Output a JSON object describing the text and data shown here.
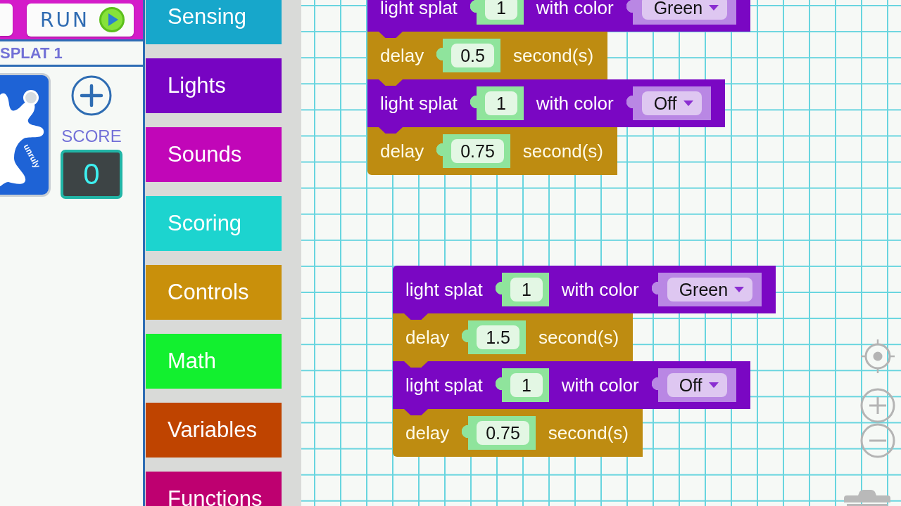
{
  "toolbar": {
    "run_button": {
      "label": "RUN"
    }
  },
  "device": {
    "name": "SPLAT 1",
    "logo_text": "unruly",
    "score_label": "SCORE",
    "score": "0"
  },
  "categories": [
    {
      "label": "Sensing",
      "color": "#17a7cb"
    },
    {
      "label": "Lights",
      "color": "#7704c2"
    },
    {
      "label": "Sounds",
      "color": "#c106b8"
    },
    {
      "label": "Scoring",
      "color": "#1cd4cf"
    },
    {
      "label": "Controls",
      "color": "#c9900b"
    },
    {
      "label": "Math",
      "color": "#12f02f"
    },
    {
      "label": "Variables",
      "color": "#bf4400"
    },
    {
      "label": "Functions",
      "color": "#be0070"
    }
  ],
  "workspace": {
    "stacks": [
      {
        "blocks": [
          {
            "kind": "light",
            "label": "light splat",
            "number": "1",
            "color_label": "with color",
            "color_choice": "Green"
          },
          {
            "kind": "delay",
            "label": "delay",
            "number": "0.5",
            "unit": "second(s)"
          },
          {
            "kind": "light",
            "label": "light splat",
            "number": "1",
            "color_label": "with color",
            "color_choice": "Off"
          },
          {
            "kind": "delay",
            "label": "delay",
            "number": "0.75",
            "unit": "second(s)"
          }
        ]
      },
      {
        "blocks": [
          {
            "kind": "light",
            "label": "light splat",
            "number": "1",
            "color_label": "with color",
            "color_choice": "Green"
          },
          {
            "kind": "delay",
            "label": "delay",
            "number": "1.5",
            "unit": "second(s)"
          },
          {
            "kind": "light",
            "label": "light splat",
            "number": "1",
            "color_label": "with color",
            "color_choice": "Off"
          },
          {
            "kind": "delay",
            "label": "delay",
            "number": "0.75",
            "unit": "second(s)"
          }
        ]
      }
    ]
  }
}
